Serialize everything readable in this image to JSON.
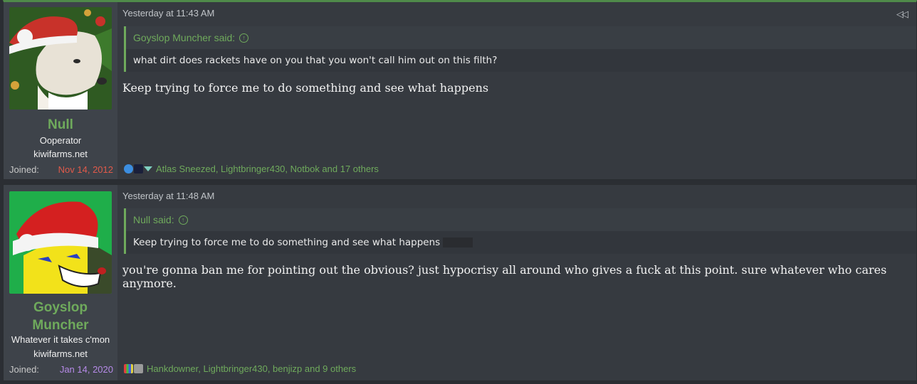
{
  "posts": [
    {
      "username": "Null",
      "user_title": "Ooperator",
      "user_site": "kiwifarms.net",
      "joined_label": "Joined:",
      "joined_date": "Nov 14, 2012",
      "joined_color": "#e05a4a",
      "timestamp": "Yesterday at 11:43 AM",
      "quote_author": "Goyslop Muncher said:",
      "quote_text": "what dirt does rackets have on you that you won't call him out on this filth?",
      "body": "Keep trying to force me to do something and see what happens",
      "reactions_text": "Atlas Sneezed, Lightbringer430, Notbok and 17 others",
      "reaction_icons": [
        "thumbs-up-icon",
        "top-hat-icon",
        "cocktail-icon"
      ]
    },
    {
      "username_line1": "Goyslop",
      "username_line2": "Muncher",
      "user_title": "Whatever it takes c'mon",
      "user_site": "kiwifarms.net",
      "joined_label": "Joined:",
      "joined_date": "Jan 14, 2020",
      "joined_color": "#b68ae8",
      "timestamp": "Yesterday at 11:48 AM",
      "quote_author": "Null said:",
      "quote_text": "Keep trying to force me to do something and see what happens",
      "body": "you're gonna ban me for pointing out the obvious? just hypocrisy all around who gives a fuck at this point. sure whatever who cares anymore.",
      "reactions_text": "Hankdowner, Lightbringer430, benjizp and 9 others",
      "reaction_icons": [
        "puzzle-icon",
        "winner-icon"
      ]
    }
  ],
  "share_icon": "rewind-icon"
}
